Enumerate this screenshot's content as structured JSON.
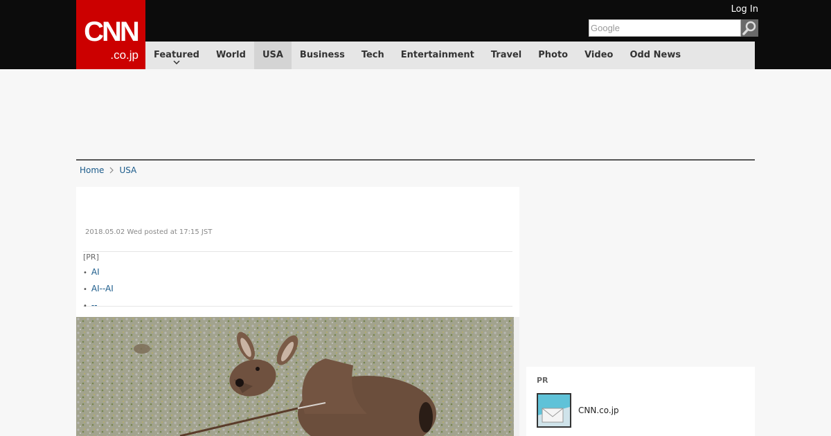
{
  "header": {
    "logo_main": "CNN",
    "logo_sub": ".co.jp",
    "login_label": "Log In",
    "search_placeholder": "Google"
  },
  "nav": {
    "items": [
      {
        "label": "Featured",
        "has_dropdown": true
      },
      {
        "label": "World"
      },
      {
        "label": "USA",
        "active": true
      },
      {
        "label": "Business"
      },
      {
        "label": "Tech"
      },
      {
        "label": "Entertainment"
      },
      {
        "label": "Travel"
      },
      {
        "label": "Photo"
      },
      {
        "label": "Video"
      },
      {
        "label": "Odd News"
      }
    ]
  },
  "breadcrumb": {
    "home": "Home",
    "section": "USA"
  },
  "article": {
    "posted": "2018.05.02 Wed posted at 17:15 JST",
    "pr_label": "[PR]",
    "pr_links": [
      "AI",
      "AI--AI",
      "--"
    ]
  },
  "sidebar": {
    "pr_label": "PR",
    "item_label": "CNN.co.jp"
  },
  "colors": {
    "brand_red": "#cc0000",
    "header_bg": "#0c0c0c",
    "nav_bg": "#e6e6e6",
    "link_blue": "#1a5a8a"
  }
}
